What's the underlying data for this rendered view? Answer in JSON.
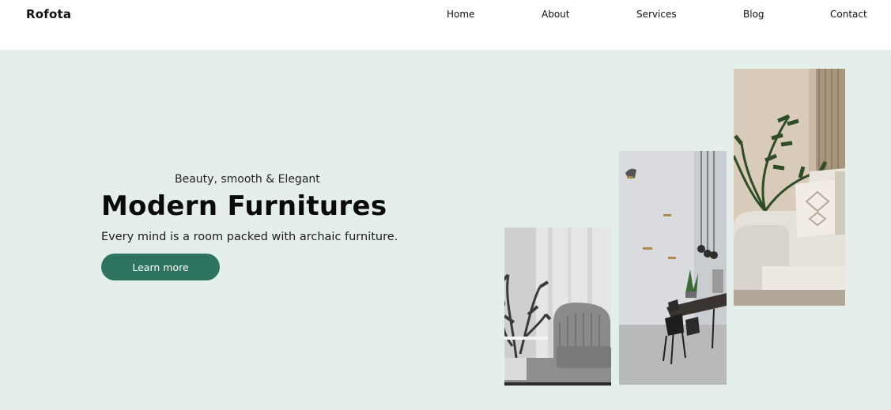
{
  "navbar": {
    "logo": "Rofota",
    "links": [
      "Home",
      "About",
      "Services",
      "Blog",
      "Contact"
    ]
  },
  "hero": {
    "tagline": "Beauty, smooth & Elegant",
    "title": "Modern Furnitures",
    "subtitle": "Every mind is a room packed with archaic furniture.",
    "cta_label": "Learn more"
  },
  "colors": {
    "hero_background": "#e4efec",
    "accent": "#2d7360",
    "navbar_background": "#ffffff"
  }
}
